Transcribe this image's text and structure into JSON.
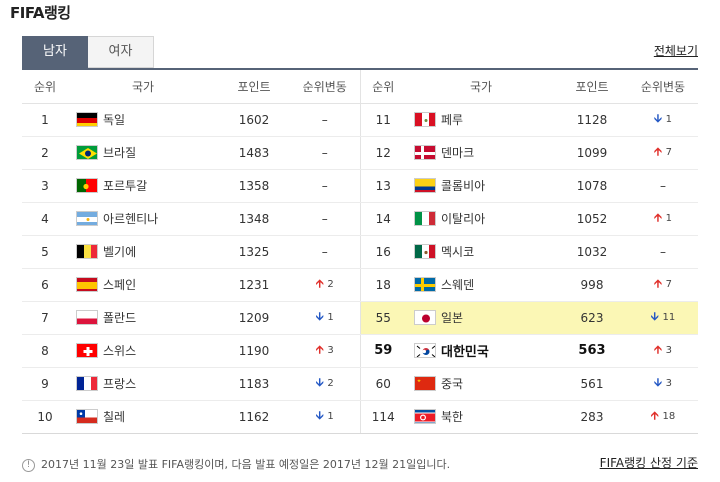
{
  "title": "FIFA랭킹",
  "tabs": [
    {
      "label": "남자",
      "active": true
    },
    {
      "label": "여자",
      "active": false
    }
  ],
  "view_all": "전체보기",
  "headers": {
    "rank": "순위",
    "country": "국가",
    "points": "포인트",
    "change": "순위변동"
  },
  "left_rows": [
    {
      "rank": "1",
      "country": "독일",
      "flag": "germany",
      "points": "1602",
      "dir": "",
      "chg": "–"
    },
    {
      "rank": "2",
      "country": "브라질",
      "flag": "brazil",
      "points": "1483",
      "dir": "",
      "chg": "–"
    },
    {
      "rank": "3",
      "country": "포르투갈",
      "flag": "portugal",
      "points": "1358",
      "dir": "",
      "chg": "–"
    },
    {
      "rank": "4",
      "country": "아르헨티나",
      "flag": "argentina",
      "points": "1348",
      "dir": "",
      "chg": "–"
    },
    {
      "rank": "5",
      "country": "벨기에",
      "flag": "belgium",
      "points": "1325",
      "dir": "",
      "chg": "–"
    },
    {
      "rank": "6",
      "country": "스페인",
      "flag": "spain",
      "points": "1231",
      "dir": "up",
      "chg": "2"
    },
    {
      "rank": "7",
      "country": "폴란드",
      "flag": "poland",
      "points": "1209",
      "dir": "down",
      "chg": "1"
    },
    {
      "rank": "8",
      "country": "스위스",
      "flag": "switzerland",
      "points": "1190",
      "dir": "up",
      "chg": "3"
    },
    {
      "rank": "9",
      "country": "프랑스",
      "flag": "france",
      "points": "1183",
      "dir": "down",
      "chg": "2"
    },
    {
      "rank": "10",
      "country": "칠레",
      "flag": "chile",
      "points": "1162",
      "dir": "down",
      "chg": "1"
    }
  ],
  "right_rows": [
    {
      "rank": "11",
      "country": "페루",
      "flag": "peru",
      "points": "1128",
      "dir": "down",
      "chg": "1",
      "hl": false,
      "bold": false
    },
    {
      "rank": "12",
      "country": "덴마크",
      "flag": "denmark",
      "points": "1099",
      "dir": "up",
      "chg": "7",
      "hl": false,
      "bold": false
    },
    {
      "rank": "13",
      "country": "콜롬비아",
      "flag": "colombia",
      "points": "1078",
      "dir": "",
      "chg": "–",
      "hl": false,
      "bold": false
    },
    {
      "rank": "14",
      "country": "이탈리아",
      "flag": "italy",
      "points": "1052",
      "dir": "up",
      "chg": "1",
      "hl": false,
      "bold": false
    },
    {
      "rank": "16",
      "country": "멕시코",
      "flag": "mexico",
      "points": "1032",
      "dir": "",
      "chg": "–",
      "hl": false,
      "bold": false
    },
    {
      "rank": "18",
      "country": "스웨덴",
      "flag": "sweden",
      "points": "998",
      "dir": "up",
      "chg": "7",
      "hl": false,
      "bold": false
    },
    {
      "rank": "55",
      "country": "일본",
      "flag": "japan",
      "points": "623",
      "dir": "down",
      "chg": "11",
      "hl": true,
      "bold": false
    },
    {
      "rank": "59",
      "country": "대한민국",
      "flag": "korea",
      "points": "563",
      "dir": "up",
      "chg": "3",
      "hl": false,
      "bold": true
    },
    {
      "rank": "60",
      "country": "중국",
      "flag": "china",
      "points": "561",
      "dir": "down",
      "chg": "3",
      "hl": false,
      "bold": false
    },
    {
      "rank": "114",
      "country": "북한",
      "flag": "northkorea",
      "points": "283",
      "dir": "up",
      "chg": "18",
      "hl": false,
      "bold": false
    }
  ],
  "footer_note": "2017년 11월 23일 발표 FIFA랭킹이며, 다음 발표 예정일은 2017년 12월 21일입니다.",
  "footer_link": "FIFA랭킹 산정 기준",
  "colors": {
    "header_accent": "#566377",
    "highlight": "#fbf7b5",
    "up": "#e0302b",
    "down": "#2458c4"
  }
}
